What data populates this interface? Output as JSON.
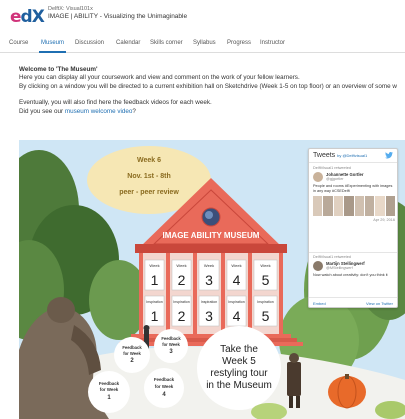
{
  "header": {
    "logo_text_e": "e",
    "logo_text_dx": "dX",
    "course_code": "DelftX: Visual101x",
    "course_name": "IMAGE | ABILITY - Visualizing the Unimaginable"
  },
  "nav": {
    "tabs": [
      {
        "label": "Course",
        "active": false
      },
      {
        "label": "Museum",
        "active": true
      },
      {
        "label": "Discussion",
        "active": false
      },
      {
        "label": "Calendar",
        "active": false
      },
      {
        "label": "Skills corner",
        "active": false
      },
      {
        "label": "Syllabus",
        "active": false
      },
      {
        "label": "Progress",
        "active": false
      },
      {
        "label": "Instructor",
        "active": false
      }
    ]
  },
  "intro": {
    "heading": "Welcome to 'The Museum'",
    "line1": "Here you can display all your coursework and view and comment on the work of your fellow learners.",
    "line2": "By clicking on a window you will be directed to a current exhibition hall on Sketchdrive (Week 1-5 on top floor) or an overview of some w",
    "line3": "Eventually, you will also find here the feedback videos for each week.",
    "line4_prefix": "Did you see our ",
    "line4_link": "museum welcome video",
    "line4_suffix": "?"
  },
  "museum": {
    "week_label": "Week 6",
    "dates": "Nov. 1st - 8th",
    "activity": "peer - peer review",
    "title": "IMAGE ABILITY MUSEUM",
    "top_row_caption": "Week",
    "bottom_row_caption": "Inspiration",
    "windows": [
      "1",
      "2",
      "3",
      "4",
      "5"
    ],
    "feedback": [
      {
        "line1": "Feedback",
        "line2": "for Week",
        "num": "1"
      },
      {
        "line1": "Feedback",
        "line2": "for Week",
        "num": "2"
      },
      {
        "line1": "Feedback",
        "line2": "for Week",
        "num": "3"
      },
      {
        "line1": "Feedback",
        "line2": "for Week",
        "num": "4"
      }
    ],
    "callout": {
      "line1": "Take the",
      "line2": "Week 5",
      "line3": "restyling tour",
      "line4": "in the Museum"
    }
  },
  "tweets": {
    "title": "Tweets",
    "by": "by @Delftvisual1",
    "retweet1": "DelftVisual1 retweeted",
    "author1": "Johannette Gortler",
    "handle1": "@gjgortler",
    "text1": "People and rooms #Experimenting with images in any way #CSEDelft",
    "date1": "Apr 29, 2016",
    "retweet2": "DelftVisual1 retweeted",
    "author2": "Martijn Stellingwerf",
    "handle2": "@MStellingwerf",
    "text2": "Now watch about creativity: don't you think it",
    "embed": "Embed",
    "view_on": "View on Twitter"
  },
  "colors": {
    "accent": "#1f6fb2",
    "edx_pink": "#d0337a",
    "edx_blue": "#1f5f9e",
    "museum_red": "#e96a5a",
    "museum_dark": "#c9473b",
    "sign_yellow": "#f6e7b4"
  }
}
